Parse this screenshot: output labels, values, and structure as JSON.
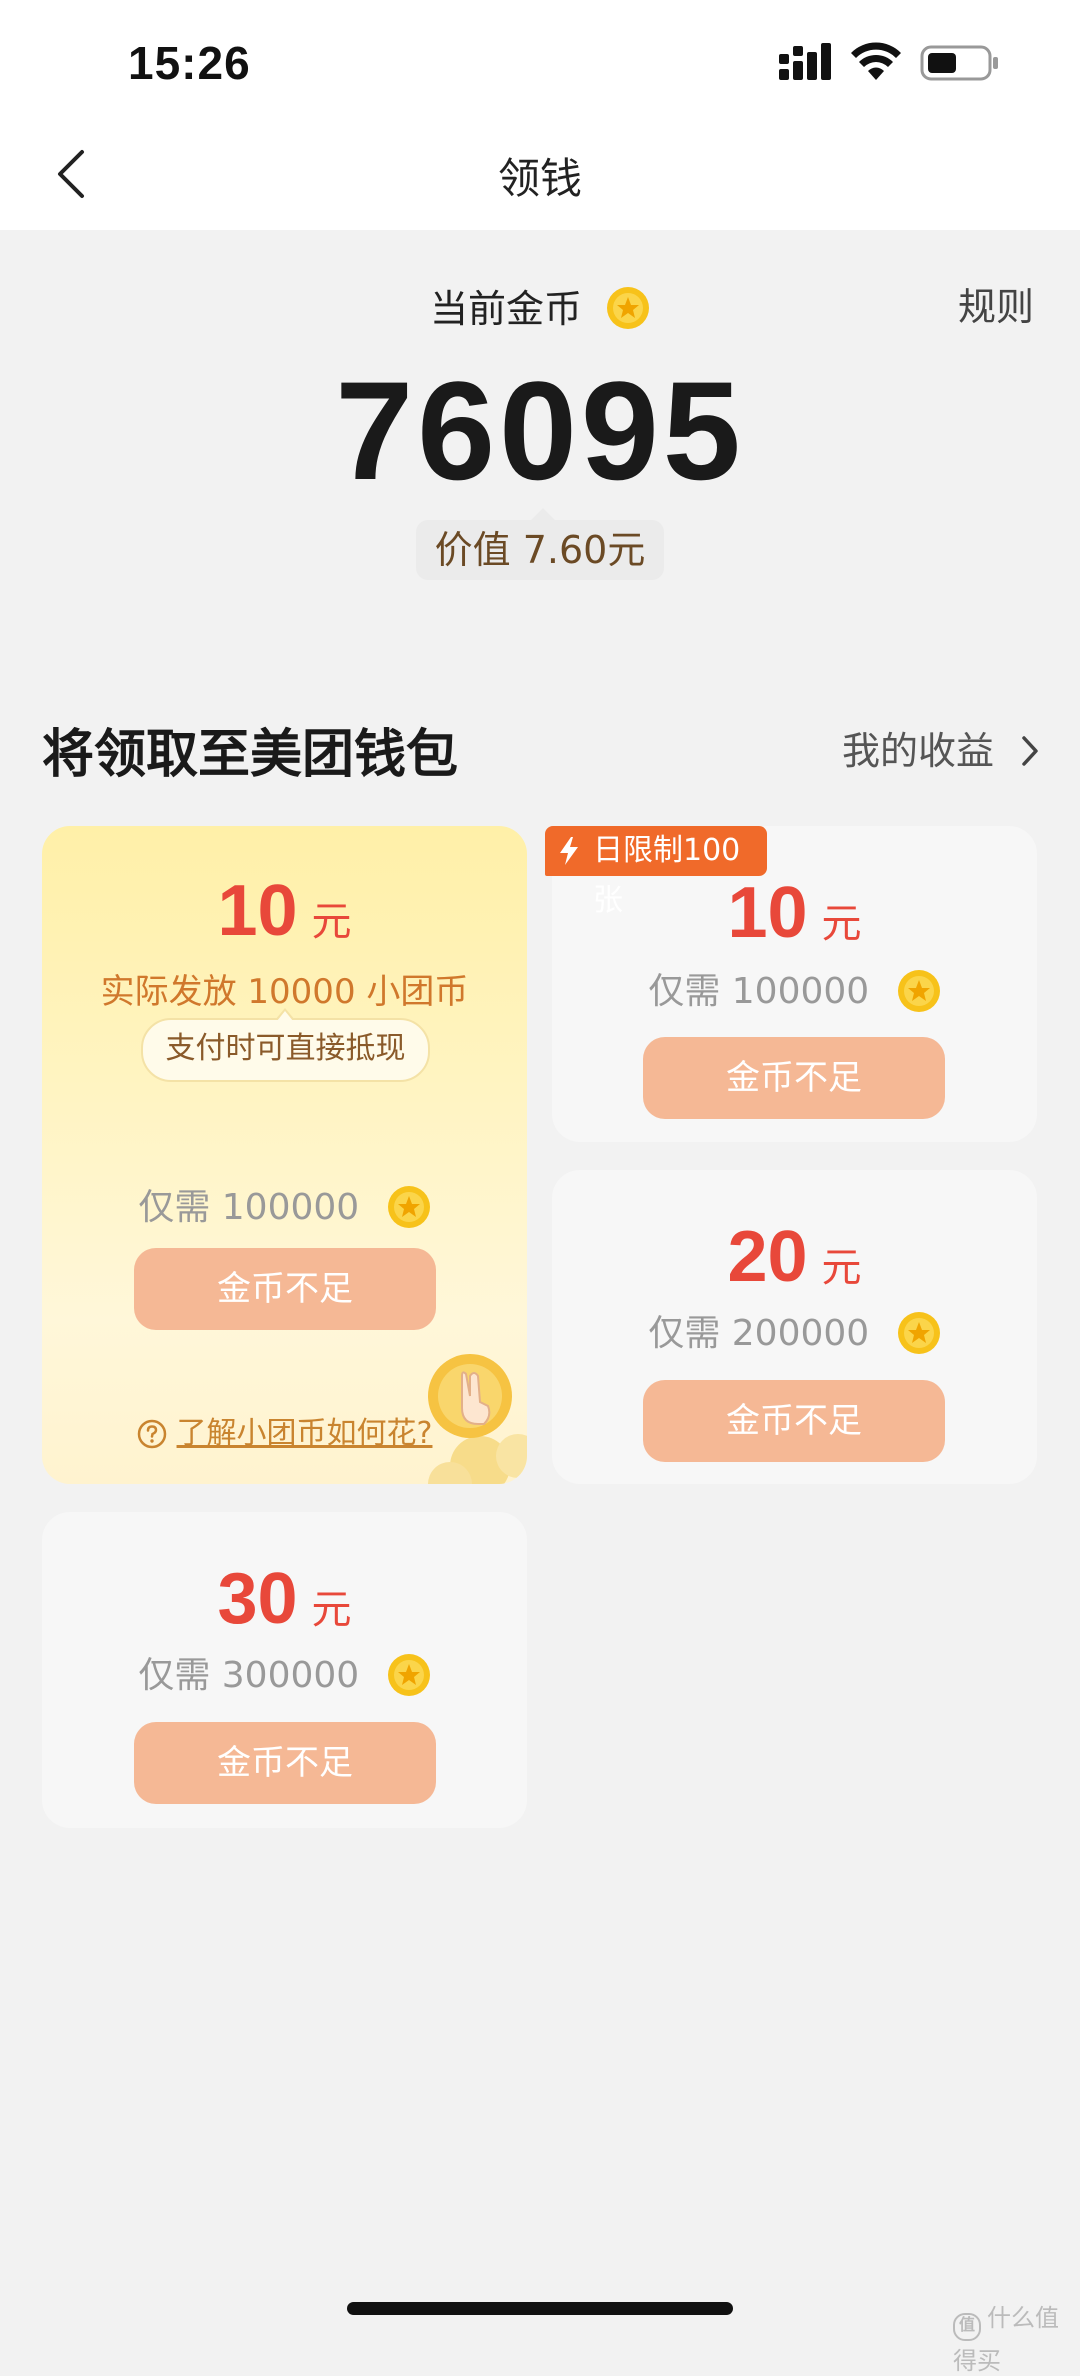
{
  "status_bar": {
    "time": "15:26"
  },
  "nav": {
    "title": "领钱"
  },
  "balance": {
    "label": "当前金币",
    "value": "76095",
    "worth": "价值 7.60元",
    "rules_label": "规则"
  },
  "section": {
    "title": "将领取至美团钱包",
    "earnings_link": "我的收益"
  },
  "featured_card": {
    "amount": "10",
    "unit": "元",
    "actual_issue": "实际发放 10000 小团币",
    "deduct_tip": "支付时可直接抵现",
    "needs": "仅需 100000",
    "button": "金币不足",
    "learn_link": "了解小团币如何花?"
  },
  "cards": [
    {
      "badge": "日限制100张",
      "amount": "10",
      "unit": "元",
      "needs": "仅需 100000",
      "button": "金币不足"
    },
    {
      "amount": "20",
      "unit": "元",
      "needs": "仅需 200000",
      "button": "金币不足"
    },
    {
      "amount": "30",
      "unit": "元",
      "needs": "仅需 300000",
      "button": "金币不足"
    }
  ],
  "watermark": {
    "text": "什么值得买",
    "badge": "值"
  },
  "colors": {
    "accent_red": "#e8483a",
    "button_disabled": "#f5b895",
    "badge_orange": "#f06a2a",
    "coin_gold": "#f7c21a"
  },
  "icons": {
    "back": "chevron-left-icon",
    "coin": "gold-coin-icon",
    "earnings_chevron": "chevron-right-icon",
    "badge": "lightning-icon",
    "help": "question-circle-icon"
  }
}
